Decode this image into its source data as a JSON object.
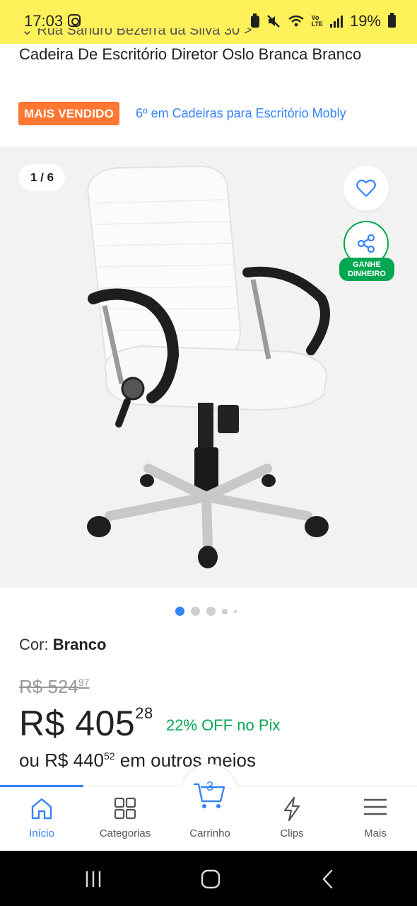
{
  "status_bar": {
    "time": "17:03",
    "battery": "19%",
    "bg_color": "#fff159"
  },
  "address_partial": "⌄ Rua Sandro Bezerra da Silva 30 >",
  "product": {
    "title": "Cadeira De Escritório Diretor Oslo Branca Branco",
    "badge": "MAIS VENDIDO",
    "rank_text": "6º em Cadeiras para Escritório Mobly"
  },
  "gallery": {
    "counter": "1 / 6",
    "favorite_icon": "heart-icon",
    "share_icon": "share-icon",
    "share_label_line1": "GANHE",
    "share_label_line2": "DINHEIRO",
    "current_index": 1,
    "total_dots": 5
  },
  "color": {
    "label": "Cor:",
    "value": "Branco"
  },
  "price": {
    "old_int": "R$ 524",
    "old_cents": "97",
    "new_int": "R$ 405",
    "new_cents": "28",
    "discount": "22% OFF no Pix",
    "installment_prefix": "ou R$ 440",
    "installment_cents": "52",
    "installment_suffix": "em outros meios"
  },
  "nav": {
    "items": [
      {
        "label": "Início",
        "icon": "home-icon",
        "active": true
      },
      {
        "label": "Categorias",
        "icon": "grid-icon"
      },
      {
        "label": "Carrinho",
        "icon": "cart-icon",
        "badge": "3"
      },
      {
        "label": "Clips",
        "icon": "bolt-icon"
      },
      {
        "label": "Mais",
        "icon": "menu-icon"
      }
    ]
  },
  "colors": {
    "accent": "#3483fa",
    "badge": "#ff7733",
    "success": "#00a650"
  }
}
